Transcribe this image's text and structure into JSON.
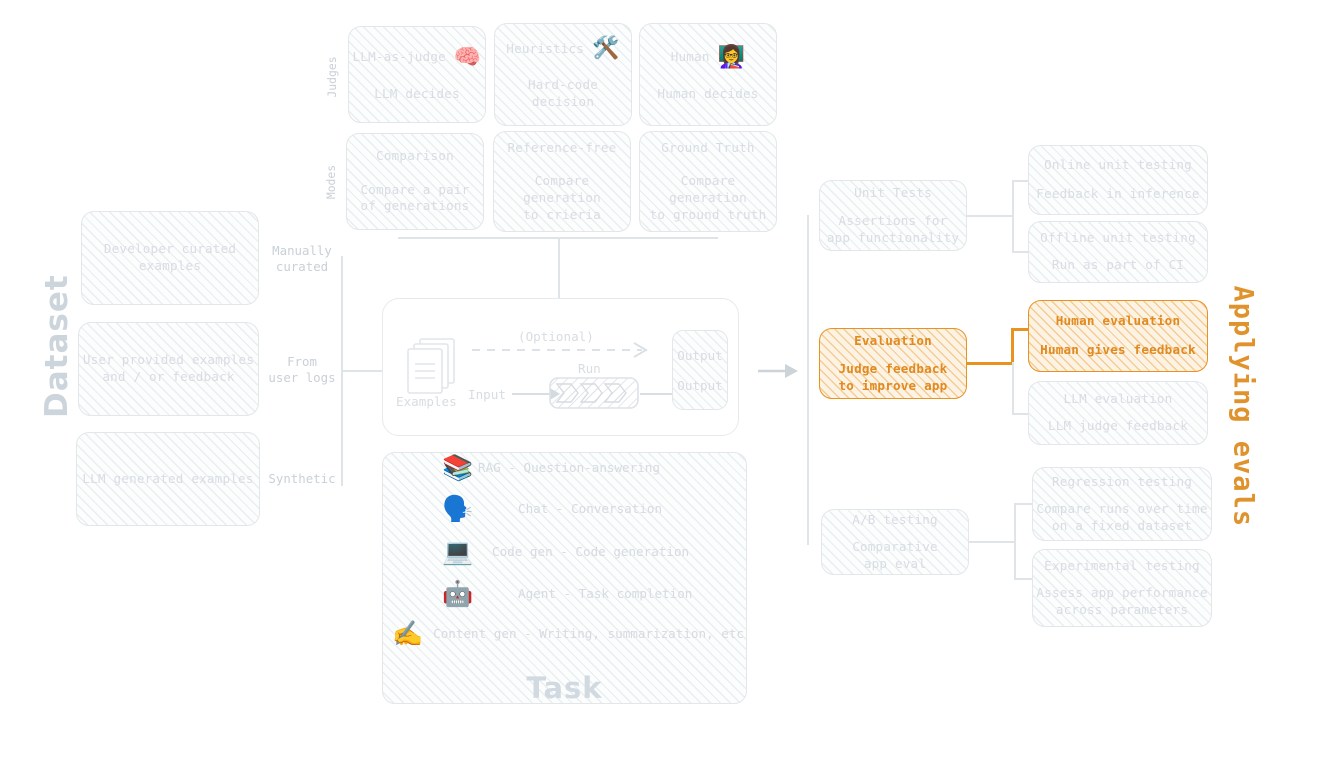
{
  "sections": {
    "dataset_label": "Dataset",
    "applying_label": "Applying evals",
    "judges_label": "Judges",
    "modes_label": "Modes",
    "task_title": "Task"
  },
  "colors": {
    "accent_orange": "#e8921f",
    "muted_gray": "#d7dde3",
    "line_gray": "#dfe4e9"
  },
  "judges": [
    {
      "title": "LLM-as-judge",
      "subtitle": "LLM decides",
      "emoji": "🧠",
      "icon": "brain-icon"
    },
    {
      "title": "Heuristics",
      "subtitle": "Hard-code decision",
      "emoji": "🛠️",
      "icon": "tools-icon"
    },
    {
      "title": "Human",
      "subtitle": "Human decides",
      "emoji": "👩‍🏫",
      "icon": "teacher-icon"
    }
  ],
  "modes": [
    {
      "title": "Comparison",
      "subtitle": "Compare a pair\nof generations"
    },
    {
      "title": "Reference-free",
      "subtitle": "Compare generation\nto crieria"
    },
    {
      "title": "Ground Truth",
      "subtitle": "Compare generation\nto ground truth"
    }
  ],
  "dataset": {
    "items": [
      {
        "box": "Developer curated\nexamples",
        "tag": "Manually\ncurated"
      },
      {
        "box": "User provided examples\nand / or feedback",
        "tag": "From\nuser logs"
      },
      {
        "box": "LLM generated examples",
        "tag": "Synthetic"
      }
    ]
  },
  "pipeline": {
    "examples_label": "Examples",
    "input_label": "Input",
    "run_label": "Run",
    "optional_label": "(Optional)",
    "output_label_top": "Output",
    "output_label_bottom": "Output"
  },
  "tasks": [
    {
      "emoji": "📚",
      "icon": "books-icon",
      "label": "RAG - Question-answering"
    },
    {
      "emoji": "🗣️",
      "icon": "speaking-head-icon",
      "label": "Chat - Conversation"
    },
    {
      "emoji": "💻",
      "icon": "laptop-icon",
      "label": "Code gen - Code generation"
    },
    {
      "emoji": "🤖",
      "icon": "robot-icon",
      "label": "Agent - Task completion"
    },
    {
      "emoji": "✍️",
      "icon": "writing-hand-icon",
      "label": "Content gen - Writing, summarization, etc"
    }
  ],
  "evals": [
    {
      "title": "Unit Tests",
      "subtitle": "Assertions for\napp functionality",
      "highlighted": false,
      "children": [
        {
          "title": "Online unit testing",
          "subtitle": "Feedback in inference",
          "highlighted": false
        },
        {
          "title": "Offline unit testing",
          "subtitle": "Run as part of CI",
          "highlighted": false
        }
      ]
    },
    {
      "title": "Evaluation",
      "subtitle": "Judge feedback\nto improve app",
      "highlighted": true,
      "children": [
        {
          "title": "Human evaluation",
          "subtitle": "Human gives feedback",
          "highlighted": true
        },
        {
          "title": "LLM evaluation",
          "subtitle": "LLM judge feedback",
          "highlighted": false
        }
      ]
    },
    {
      "title": "A/B testing",
      "subtitle": "Comparative\napp eval",
      "highlighted": false,
      "children": [
        {
          "title": "Regression testing",
          "subtitle": "Compare runs over time\non a fixed dataset",
          "highlighted": false
        },
        {
          "title": "Experimental testing",
          "subtitle": "Assess app performance\nacross parameters",
          "highlighted": false
        }
      ]
    }
  ]
}
